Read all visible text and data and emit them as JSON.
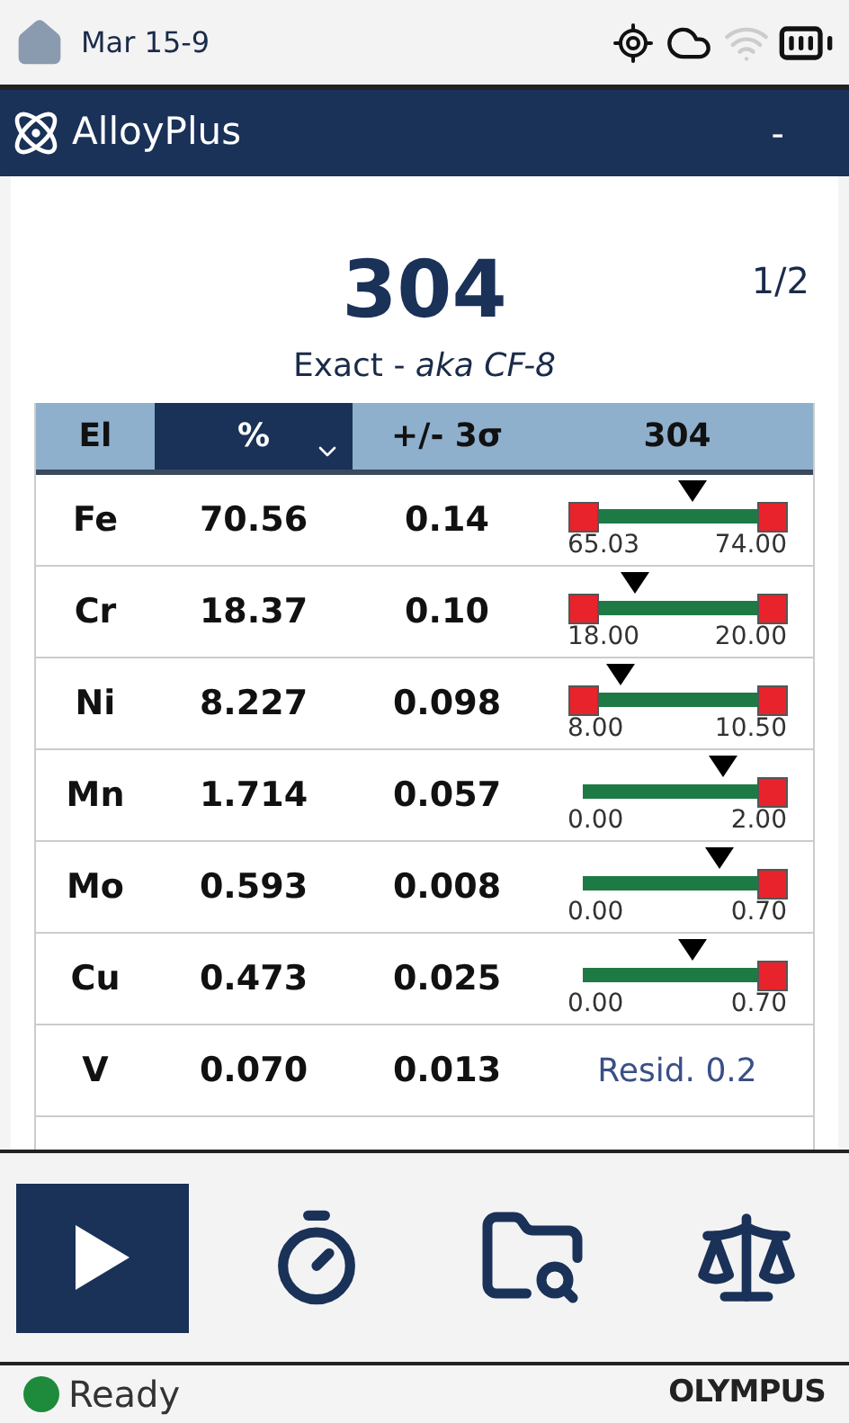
{
  "status_bar": {
    "date": "Mar 15-9"
  },
  "header": {
    "title": "AlloyPlus",
    "menu": "-"
  },
  "result": {
    "grade": "304",
    "page": "1/2",
    "match": "Exact - *aka CF-8*"
  },
  "table": {
    "columns": [
      {
        "label": "El",
        "selected": false,
        "sortable": false
      },
      {
        "label": "%",
        "selected": true,
        "sortable": true
      },
      {
        "label": "+/- 3σ",
        "selected": false,
        "sortable": false
      },
      {
        "label": "304",
        "selected": false,
        "sortable": false
      }
    ],
    "rows": [
      {
        "element": "Fe",
        "percent": "70.56",
        "sigma": "0.14",
        "kind": "range",
        "low_flag": true,
        "level": 0.58,
        "min": "65.03",
        "max": "74.00"
      },
      {
        "element": "Cr",
        "percent": "18.37",
        "sigma": "0.10",
        "kind": "range",
        "low_flag": true,
        "level": 0.28,
        "min": "18.00",
        "max": "20.00"
      },
      {
        "element": "Ni",
        "percent": "8.227",
        "sigma": "0.098",
        "kind": "range",
        "low_flag": true,
        "level": 0.2,
        "min": "8.00",
        "max": "10.50"
      },
      {
        "element": "Mn",
        "percent": "1.714",
        "sigma": "0.057",
        "kind": "range",
        "low_flag": false,
        "level": 0.74,
        "min": "0.00",
        "max": "2.00"
      },
      {
        "element": "Mo",
        "percent": "0.593",
        "sigma": "0.008",
        "kind": "range",
        "low_flag": false,
        "level": 0.72,
        "min": "0.00",
        "max": "0.70"
      },
      {
        "element": "Cu",
        "percent": "0.473",
        "sigma": "0.025",
        "kind": "range",
        "low_flag": false,
        "level": 0.58,
        "min": "0.00",
        "max": "0.70"
      },
      {
        "element": "V",
        "percent": "0.070",
        "sigma": "0.013",
        "kind": "residual",
        "residual": "Resid. 0.2"
      }
    ]
  },
  "toolbar": [
    {
      "kind": "play",
      "selected": true
    },
    {
      "kind": "timer",
      "selected": false
    },
    {
      "kind": "folder-search",
      "selected": false
    },
    {
      "kind": "scale",
      "selected": false
    }
  ],
  "footer": {
    "status": "Ready",
    "color": "#1e8a3c",
    "brand": "OLYMPUS"
  }
}
